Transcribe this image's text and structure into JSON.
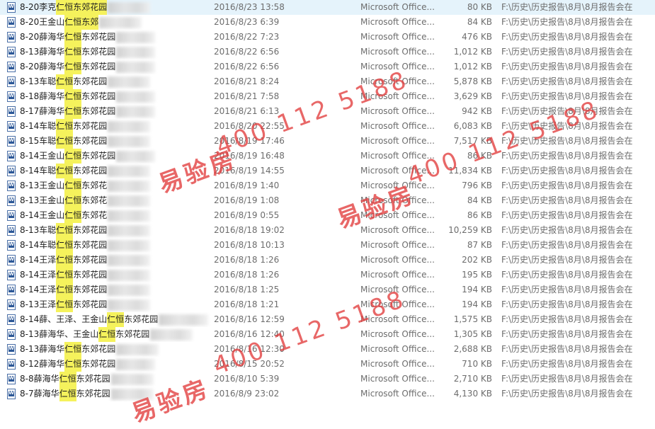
{
  "files": [
    {
      "prefix": "8-20李克",
      "mid": "仁恒东郊花园",
      "suffix": "",
      "blur": 60,
      "date": "2016/8/23 13:58",
      "type": "Microsoft Office...",
      "size": "80 KB",
      "path": "F:\\历史\\历史报告\\8月\\8月报告会在"
    },
    {
      "prefix": "8-20王金山",
      "mid": "仁恒东郊",
      "suffix": "",
      "blur": 60,
      "date": "2016/8/23 6:39",
      "type": "Microsoft Office...",
      "size": "84 KB",
      "path": "F:\\历史\\历史报告\\8月\\8月报告会在"
    },
    {
      "prefix": "8-20薛海华",
      "mid": "仁恒",
      "suffix": "东郊花园",
      "blur": 55,
      "date": "2016/8/22 7:23",
      "type": "Microsoft Office...",
      "size": "476 KB",
      "path": "F:\\历史\\历史报告\\8月\\8月报告会在"
    },
    {
      "prefix": "8-13薛海华",
      "mid": "仁恒",
      "suffix": "东郊花园",
      "blur": 55,
      "date": "2016/8/22 6:56",
      "type": "Microsoft Office...",
      "size": "1,012 KB",
      "path": "F:\\历史\\历史报告\\8月\\8月报告会在"
    },
    {
      "prefix": "8-20薛海华",
      "mid": "仁恒",
      "suffix": "东郊花园",
      "blur": 55,
      "date": "2016/8/22 6:56",
      "type": "Microsoft Office...",
      "size": "1,012 KB",
      "path": "F:\\历史\\历史报告\\8月\\8月报告会在"
    },
    {
      "prefix": "8-13车聪",
      "mid": "仁恒",
      "suffix": "东郊花园",
      "blur": 60,
      "date": "2016/8/21 8:24",
      "type": "Microsoft Office...",
      "size": "5,878 KB",
      "path": "F:\\历史\\历史报告\\8月\\8月报告会在"
    },
    {
      "prefix": "8-18薛海华",
      "mid": "仁恒",
      "suffix": "东郊花园",
      "blur": 55,
      "date": "2016/8/21 7:58",
      "type": "Microsoft Office...",
      "size": "3,629 KB",
      "path": "F:\\历史\\历史报告\\8月\\8月报告会在"
    },
    {
      "prefix": "8-17薛海华",
      "mid": "仁恒",
      "suffix": "东郊花园",
      "blur": 55,
      "date": "2016/8/21 6:13",
      "type": "Microsoft Office...",
      "size": "942 KB",
      "path": "F:\\历史\\历史报告\\8月\\8月报告会在"
    },
    {
      "prefix": "8-14车聪",
      "mid": "仁恒",
      "suffix": "东郊花园",
      "blur": 60,
      "date": "2016/8/20 22:55",
      "type": "Microsoft Office...",
      "size": "6,083 KB",
      "path": "F:\\历史\\历史报告\\8月\\8月报告会在"
    },
    {
      "prefix": "8-15车聪",
      "mid": "仁恒",
      "suffix": "东郊花园",
      "blur": 60,
      "date": "2016/8/19 17:46",
      "type": "Microsoft Office...",
      "size": "7,517 KB",
      "path": "F:\\历史\\历史报告\\8月\\8月报告会在"
    },
    {
      "prefix": "8-14王金山",
      "mid": "仁恒",
      "suffix": "东郊花园",
      "blur": 55,
      "date": "2016/8/19 16:48",
      "type": "Microsoft Office...",
      "size": "86 KB",
      "path": "F:\\历史\\历史报告\\8月\\8月报告会在"
    },
    {
      "prefix": "8-14车聪",
      "mid": "仁恒",
      "suffix": "东郊花园",
      "blur": 60,
      "date": "2016/8/19 14:55",
      "type": "Microsoft Office...",
      "size": "11,834 KB",
      "path": "F:\\历史\\历史报告\\8月\\8月报告会在"
    },
    {
      "prefix": "8-13王金山",
      "mid": "仁恒",
      "suffix": "东郊花",
      "blur": 60,
      "date": "2016/8/19 1:40",
      "type": "Microsoft Office...",
      "size": "796 KB",
      "path": "F:\\历史\\历史报告\\8月\\8月报告会在"
    },
    {
      "prefix": "8-13王金山",
      "mid": "仁恒",
      "suffix": "东郊花",
      "blur": 60,
      "date": "2016/8/19 1:08",
      "type": "Microsoft Office...",
      "size": "84 KB",
      "path": "F:\\历史\\历史报告\\8月\\8月报告会在"
    },
    {
      "prefix": "8-14王金山",
      "mid": "仁恒",
      "suffix": "东郊花",
      "blur": 60,
      "date": "2016/8/19 0:55",
      "type": "Microsoft Office...",
      "size": "86 KB",
      "path": "F:\\历史\\历史报告\\8月\\8月报告会在"
    },
    {
      "prefix": "8-13车聪",
      "mid": "仁恒",
      "suffix": "东郊花园",
      "blur": 60,
      "date": "2016/8/18 19:02",
      "type": "Microsoft Office...",
      "size": "10,259 KB",
      "path": "F:\\历史\\历史报告\\8月\\8月报告会在"
    },
    {
      "prefix": "8-14车聪",
      "mid": "仁恒",
      "suffix": "东郊花园",
      "blur": 60,
      "date": "2016/8/18 10:13",
      "type": "Microsoft Office...",
      "size": "87 KB",
      "path": "F:\\历史\\历史报告\\8月\\8月报告会在"
    },
    {
      "prefix": "8-14王泽",
      "mid": "仁恒",
      "suffix": "东郊花园",
      "blur": 60,
      "date": "2016/8/18 1:26",
      "type": "Microsoft Office...",
      "size": "202 KB",
      "path": "F:\\历史\\历史报告\\8月\\8月报告会在"
    },
    {
      "prefix": "8-14王泽",
      "mid": "仁恒",
      "suffix": "东郊花园",
      "blur": 60,
      "date": "2016/8/18 1:26",
      "type": "Microsoft Office...",
      "size": "195 KB",
      "path": "F:\\历史\\历史报告\\8月\\8月报告会在"
    },
    {
      "prefix": "8-14王泽",
      "mid": "仁恒",
      "suffix": "东郊花园",
      "blur": 60,
      "date": "2016/8/18 1:25",
      "type": "Microsoft Office...",
      "size": "194 KB",
      "path": "F:\\历史\\历史报告\\8月\\8月报告会在"
    },
    {
      "prefix": "8-13王泽",
      "mid": "仁恒",
      "suffix": "东郊花园",
      "blur": 60,
      "date": "2016/8/18 1:21",
      "type": "Microsoft Office...",
      "size": "194 KB",
      "path": "F:\\历史\\历史报告\\8月\\8月报告会在"
    },
    {
      "prefix": "8-14薛、王泽、王金山",
      "mid": "仁恒",
      "suffix": "东郊花园",
      "blur": 70,
      "date": "2016/8/16 12:59",
      "type": "Microsoft Office...",
      "size": "1,575 KB",
      "path": "F:\\历史\\历史报告\\8月\\8月报告会在"
    },
    {
      "prefix": "8-13薛海华、王金山",
      "mid": "仁恒",
      "suffix": "东郊花园",
      "blur": 60,
      "date": "2016/8/16 12:40",
      "type": "Microsoft Office...",
      "size": "1,305 KB",
      "path": "F:\\历史\\历史报告\\8月\\8月报告会在"
    },
    {
      "prefix": "8-13薛海华",
      "mid": "仁恒",
      "suffix": "东郊花园",
      "blur": 60,
      "date": "2016/8/16 12:30",
      "type": "Microsoft Office...",
      "size": "2,688 KB",
      "path": "F:\\历史\\历史报告\\8月\\8月报告会在"
    },
    {
      "prefix": "8-12薛海华",
      "mid": "仁恒",
      "suffix": "东郊花园",
      "blur": 55,
      "date": "2016/8/15 20:52",
      "type": "Microsoft Office...",
      "size": "710 KB",
      "path": "F:\\历史\\历史报告\\8月\\8月报告会在"
    },
    {
      "prefix": "8-8薛海华",
      "mid": "仁恒",
      "suffix": "东郊花园",
      "blur": 60,
      "date": "2016/8/10 5:39",
      "type": "Microsoft Office...",
      "size": "2,710 KB",
      "path": "F:\\历史\\历史报告\\8月\\8月报告会在"
    },
    {
      "prefix": "8-7薛海华",
      "mid": "仁恒",
      "suffix": "东郊花园",
      "blur": 60,
      "date": "2016/8/9 23:02",
      "type": "Microsoft Office...",
      "size": "4,130 KB",
      "path": "F:\\历史\\历史报告\\8月\\8月报告会在"
    }
  ],
  "watermarks": [
    {
      "kind": "cn",
      "text": "易验房"
    },
    {
      "kind": "num",
      "text": "400 112 5188"
    },
    {
      "kind": "cn",
      "text": "易验房"
    },
    {
      "kind": "num",
      "text": "400 112 5188"
    },
    {
      "kind": "cn",
      "text": "易验房"
    },
    {
      "kind": "num",
      "text": "400 112 5188"
    }
  ],
  "colors": {
    "highlight": "#f5f25c",
    "watermark": "#e13c3c",
    "secondary_text": "#6d6d6d"
  }
}
